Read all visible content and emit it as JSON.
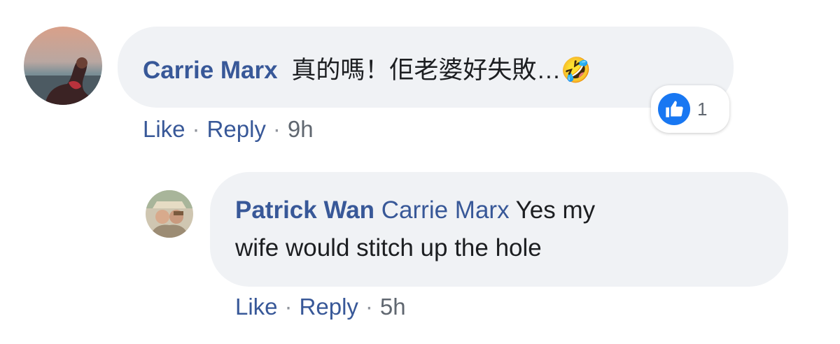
{
  "comments": [
    {
      "author": "Carrie Marx",
      "text": "真的嗎！佢老婆好失敗…",
      "emoji": "🤣",
      "reaction_count": "1",
      "actions": {
        "like": "Like",
        "reply": "Reply",
        "time": "9h"
      }
    },
    {
      "author": "Patrick Wan",
      "mention": "Carrie Marx",
      "text_line1": "Yes my",
      "text_line2": "wife would stitch up the hole",
      "actions": {
        "like": "Like",
        "reply": "Reply",
        "time": "5h"
      }
    }
  ],
  "separator": "·",
  "colors": {
    "author_link": "#385898",
    "bubble_bg": "#f0f2f5",
    "like_blue": "#1877f2",
    "text": "#1c1e21",
    "meta_gray": "#606770"
  },
  "icons": [
    "avatar-carrie-marx",
    "avatar-patrick-wan",
    "rolling-laughing-emoji-icon",
    "thumbs-up-icon"
  ]
}
